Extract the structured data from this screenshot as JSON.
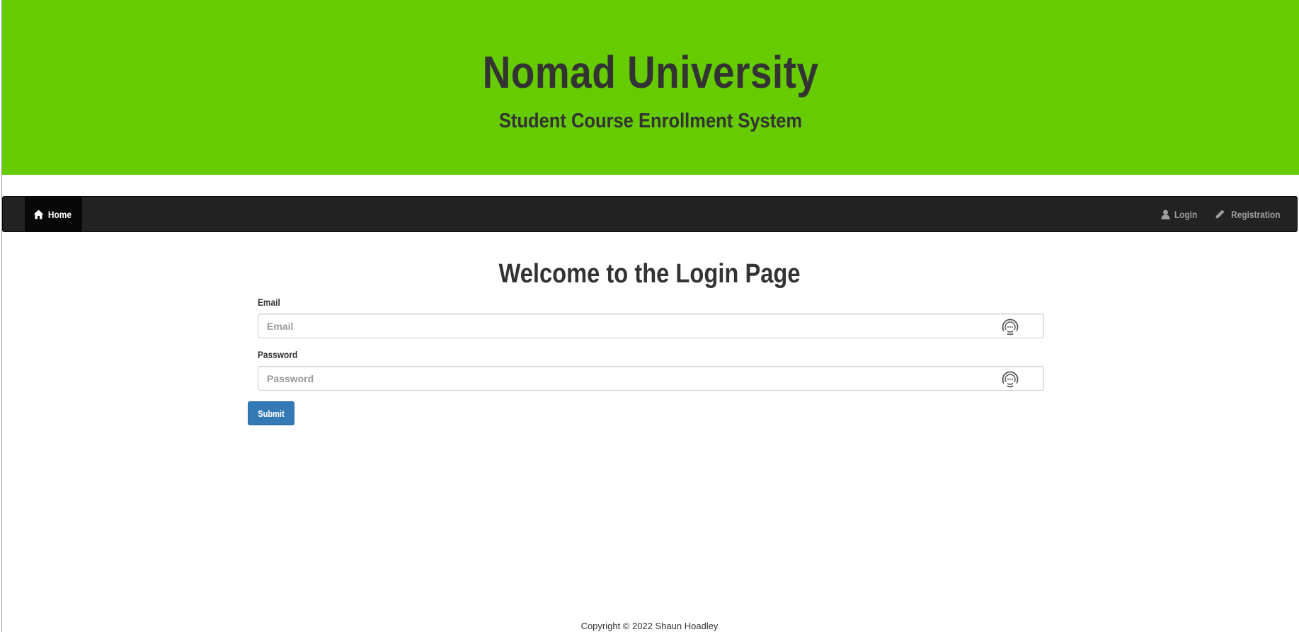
{
  "header": {
    "title": "Nomad University",
    "subtitle": "Student Course Enrollment System",
    "background_color": "#66cc00"
  },
  "navbar": {
    "home": {
      "label": "Home",
      "icon": "home-icon"
    },
    "login": {
      "label": "Login",
      "icon": "user-icon"
    },
    "registration": {
      "label": "Registration",
      "icon": "pencil-icon"
    }
  },
  "main": {
    "heading": "Welcome to the Login Page",
    "email": {
      "label": "Email",
      "placeholder": "Email",
      "value": ""
    },
    "password": {
      "label": "Password",
      "placeholder": "Password",
      "value": ""
    },
    "submit_label": "Submit"
  },
  "footer": {
    "copyright": "Copyright © 2022 Shaun Hoadley"
  }
}
